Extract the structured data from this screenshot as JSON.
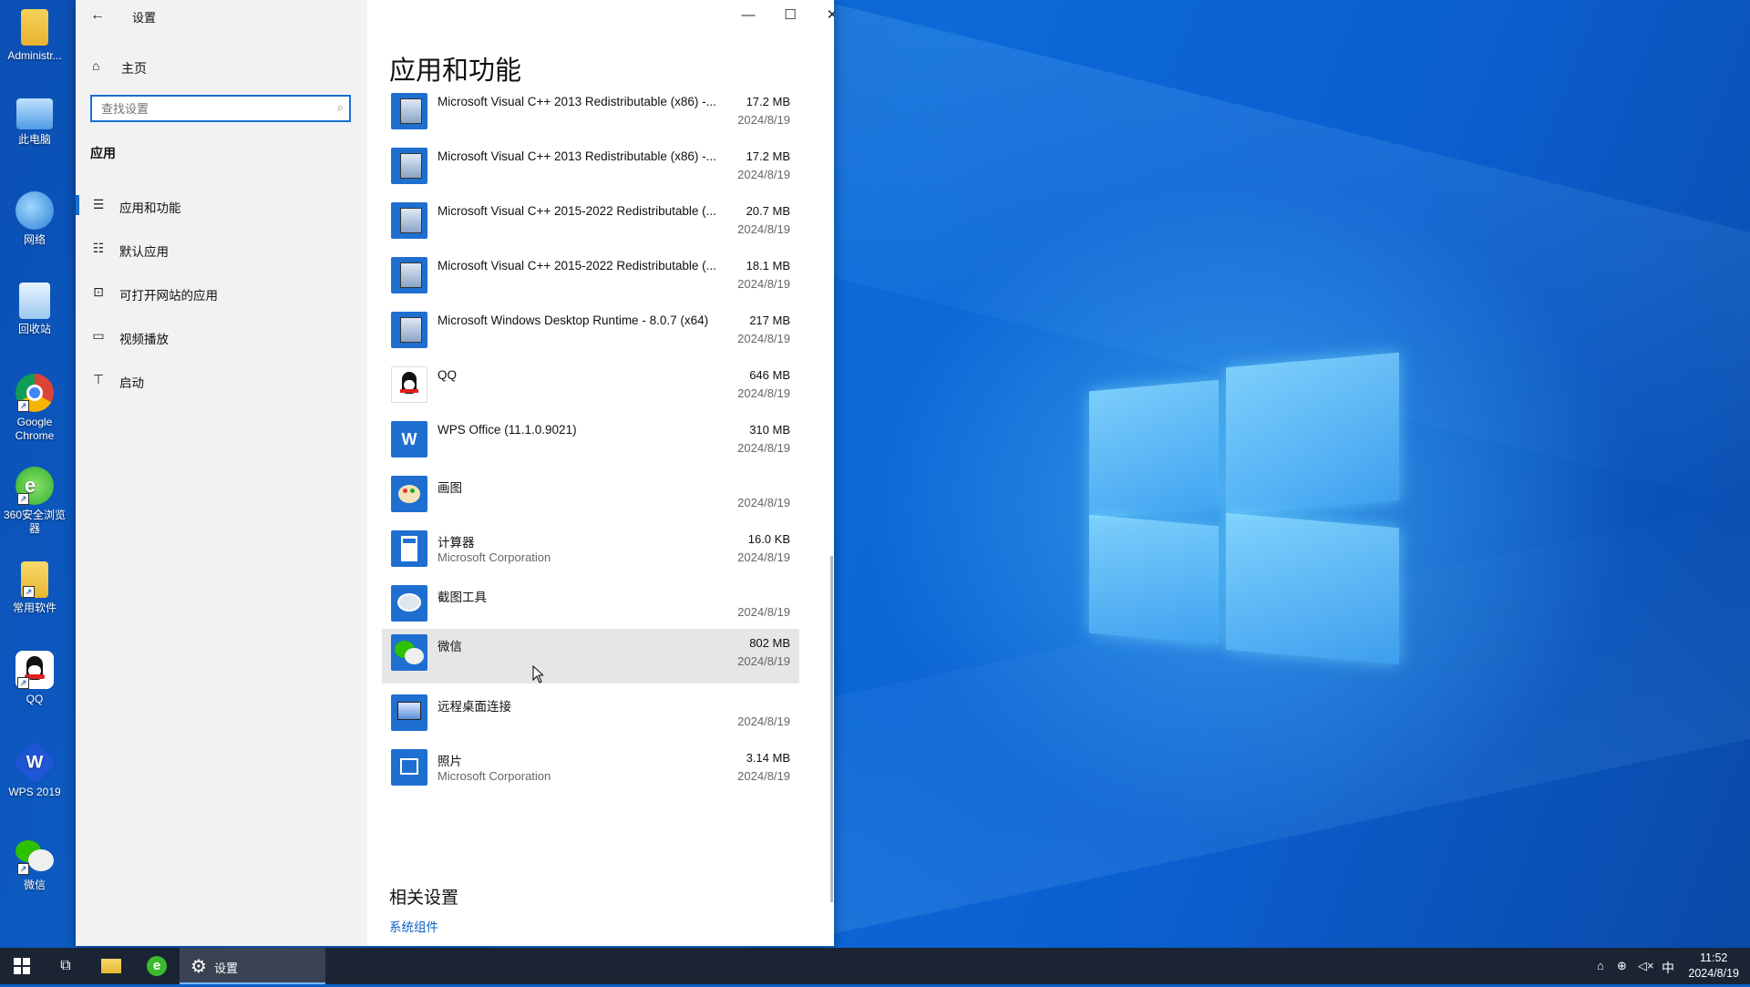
{
  "desktop": {
    "icons": [
      {
        "label": "Administr..."
      },
      {
        "label": "此电脑"
      },
      {
        "label": "网络"
      },
      {
        "label": "回收站"
      },
      {
        "label": "Google Chrome"
      },
      {
        "label": "360安全浏览器"
      },
      {
        "label": "常用软件"
      },
      {
        "label": "QQ"
      },
      {
        "label": "WPS 2019"
      },
      {
        "label": "微信"
      }
    ]
  },
  "window": {
    "title": "设置",
    "controls": {
      "minimize": "—",
      "maximize": "☐",
      "close": "✕"
    }
  },
  "sidebar": {
    "home_label": "主页",
    "search_placeholder": "查找设置",
    "section": "应用",
    "items": [
      {
        "label": "应用和功能",
        "active": true
      },
      {
        "label": "默认应用"
      },
      {
        "label": "可打开网站的应用"
      },
      {
        "label": "视频播放"
      },
      {
        "label": "启动"
      }
    ]
  },
  "main": {
    "title": "应用和功能",
    "apps": [
      {
        "name": "Microsoft Visual C++ 2013 Redistributable (x86) -...",
        "publisher": "",
        "size": "17.2 MB",
        "date": "2024/8/19",
        "icon": "installer-icon"
      },
      {
        "name": "Microsoft Visual C++ 2013 Redistributable (x86) -...",
        "publisher": "",
        "size": "17.2 MB",
        "date": "2024/8/19",
        "icon": "installer-icon"
      },
      {
        "name": "Microsoft Visual C++ 2015-2022 Redistributable (...",
        "publisher": "",
        "size": "20.7 MB",
        "date": "2024/8/19",
        "icon": "installer-icon"
      },
      {
        "name": "Microsoft Visual C++ 2015-2022 Redistributable (...",
        "publisher": "",
        "size": "18.1 MB",
        "date": "2024/8/19",
        "icon": "installer-icon"
      },
      {
        "name": "Microsoft Windows Desktop Runtime - 8.0.7 (x64)",
        "publisher": "",
        "size": "217 MB",
        "date": "2024/8/19",
        "icon": "installer-icon"
      },
      {
        "name": "QQ",
        "publisher": "",
        "size": "646 MB",
        "date": "2024/8/19",
        "icon": "qq-icon"
      },
      {
        "name": "WPS Office (11.1.0.9021)",
        "publisher": "",
        "size": "310 MB",
        "date": "2024/8/19",
        "icon": "wps-icon"
      },
      {
        "name": "画图",
        "publisher": "",
        "size": "",
        "date": "2024/8/19",
        "icon": "paint-icon"
      },
      {
        "name": "计算器",
        "publisher": "Microsoft Corporation",
        "size": "16.0 KB",
        "date": "2024/8/19",
        "icon": "calculator-icon"
      },
      {
        "name": "截图工具",
        "publisher": "",
        "size": "",
        "date": "2024/8/19",
        "icon": "snipping-tool-icon"
      },
      {
        "name": "微信",
        "publisher": "",
        "size": "802 MB",
        "date": "2024/8/19",
        "icon": "wechat-icon",
        "hover": true
      },
      {
        "name": "远程桌面连接",
        "publisher": "",
        "size": "",
        "date": "2024/8/19",
        "icon": "remote-desktop-icon"
      },
      {
        "name": "照片",
        "publisher": "Microsoft Corporation",
        "size": "3.14 MB",
        "date": "2024/8/19",
        "icon": "photos-icon"
      }
    ],
    "related_title": "相关设置",
    "related_link": "系统组件"
  },
  "taskbar": {
    "settings_label": "设置",
    "ime": "中",
    "time": "11:52",
    "date": "2024/8/19"
  },
  "colors": {
    "accent": "#1a6fd0",
    "link": "#0a5fc0",
    "taskbar": "#1b2433"
  }
}
